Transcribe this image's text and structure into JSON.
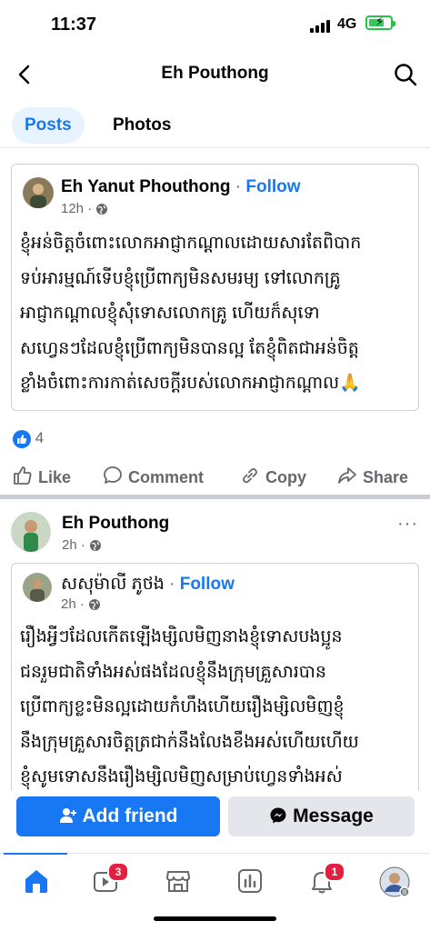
{
  "status": {
    "time": "11:37",
    "network": "4G",
    "battery_bolt": "⚡"
  },
  "nav": {
    "back_glyph": "‹",
    "title": "Eh Pouthong"
  },
  "tabs": [
    {
      "label": "Posts",
      "active": true
    },
    {
      "label": "Photos",
      "active": false
    }
  ],
  "post1": {
    "shared": {
      "author": "Eh Yanut Phouthong",
      "separator": "·",
      "follow": "Follow",
      "time": "12h",
      "separator2": "·",
      "lines": [
        "ខ្ញុំអន់ចិត្តចំពោះលោកអាជ្ញាកណ្តាលដោយសារតែពិបាក",
        "ទប់អារម្មណ៍ទើបខ្ញុំប្រើពាក្យមិនសមរម្យ ទៅលោកគ្រូ",
        "អាជ្ញាកណ្តាលខ្ញុំសុំទោសលោកគ្រូ ហើយក៏សុទោ",
        "សហ្វេនៗដែលខ្ញុំប្រើពាក្យមិនបានល្អ តែខ្ញុំពិតជាអន់ចិត្ត",
        "ខ្លាំងចំពោះការកាត់សេចក្ដីរបស់លោកអាជ្ញាកណ្តាល🙏"
      ]
    },
    "reaction_count": "4",
    "actions": {
      "like": "Like",
      "comment": "Comment",
      "copy": "Copy",
      "share": "Share"
    }
  },
  "post2": {
    "author": "Eh Pouthong",
    "time": "2h",
    "separator": "·",
    "more": "···",
    "shared": {
      "author": "សសុម៉ាលី ភូថង",
      "separator": "·",
      "follow": "Follow",
      "time": "2h",
      "separator2": "·",
      "lines": [
        "រឿងអ្វីៗដែលកើតឡើងម្សិលមិញនាងខ្ញុំទោសបងប្អូន",
        "ជនរួមជាតិទាំងអស់ផងដែលខ្ញុំនឹងក្រុមគ្រួសារបាន",
        "ប្រើពាក្យខ្លះមិនល្អដោយកំហឹងហើយរឿងម្សិលមិញខ្ញុំ",
        "នឹងក្រុមគ្រួសារចិត្តត្រជាក់នឹងលែងខឹងអស់ហើយហើយ",
        "ខ្ញុំសូមទោសនឹងរឿងម្សិលមិញសម្រាប់ហ្វេនទាំងអស់"
      ]
    }
  },
  "bottom_actions": {
    "add_friend": "Add friend",
    "message": "Message"
  },
  "tabbar": {
    "items": [
      "home",
      "video",
      "marketplace",
      "dashboard",
      "notifications",
      "profile"
    ],
    "video_badge": "3",
    "notifications_badge": "1"
  },
  "colors": {
    "accent": "#1877f2",
    "badge": "#e41e3f",
    "text_secondary": "#65676b",
    "active_tab_bg": "#e7f3ff"
  }
}
